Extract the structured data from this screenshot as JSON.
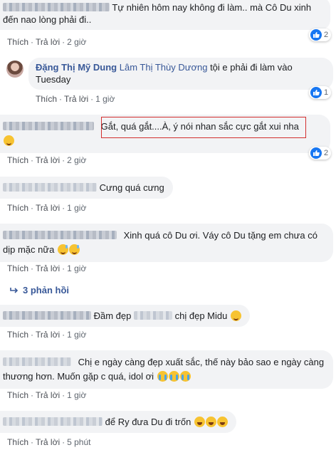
{
  "actions": {
    "like": "Thích",
    "reply": "Trả lời",
    "separator": "·"
  },
  "comments": [
    {
      "text": "Tự nhiên hôm nay không đi làm.. mà Cô Du xinh đến nao lòng phải đi..",
      "time": "2 giờ",
      "likes": "2"
    },
    {
      "author": "Đặng Thị Mỹ Dung",
      "mention": "Lâm Thị Thùy Dương",
      "text": "tội e phải đi làm vào Tuesday",
      "time": "1 giờ",
      "likes": "1"
    },
    {
      "text": "Gắt, quá gắt....À, ý nói nhan sắc cực gắt xui nha",
      "time": "2 giờ",
      "likes": "2"
    },
    {
      "text": "Cưng quá cưng",
      "time": "1 giờ"
    },
    {
      "text": "Xinh quá cô Du ơi. Váy cô Du tặng em chưa có dịp mặc nữa",
      "time": "1 giờ"
    },
    {
      "text_a": "Đầm đẹp",
      "text_b": "chị đẹp Midu",
      "time": "1 giờ"
    },
    {
      "text": "Chị e ngày càng đẹp xuất sắc, thế này bảo sao e ngày càng thương hơn. Muốn gặp c quá, idol ơi",
      "time": "1 giờ"
    },
    {
      "text": "để Ry đưa Du đi trốn",
      "time": "5 phút"
    }
  ],
  "replies_link": "3 phản hồi",
  "colors": {
    "link_blue": "#385898",
    "like_blue": "#1877f2",
    "bubble_gray": "#f2f3f5",
    "highlight_red": "#d32f2f"
  },
  "icons": [
    "like-icon",
    "smile-emoji",
    "sweat-smile-emoji",
    "wink-emoji",
    "crying-emoji",
    "laughing-emoji",
    "reply-arrow-icon"
  ]
}
